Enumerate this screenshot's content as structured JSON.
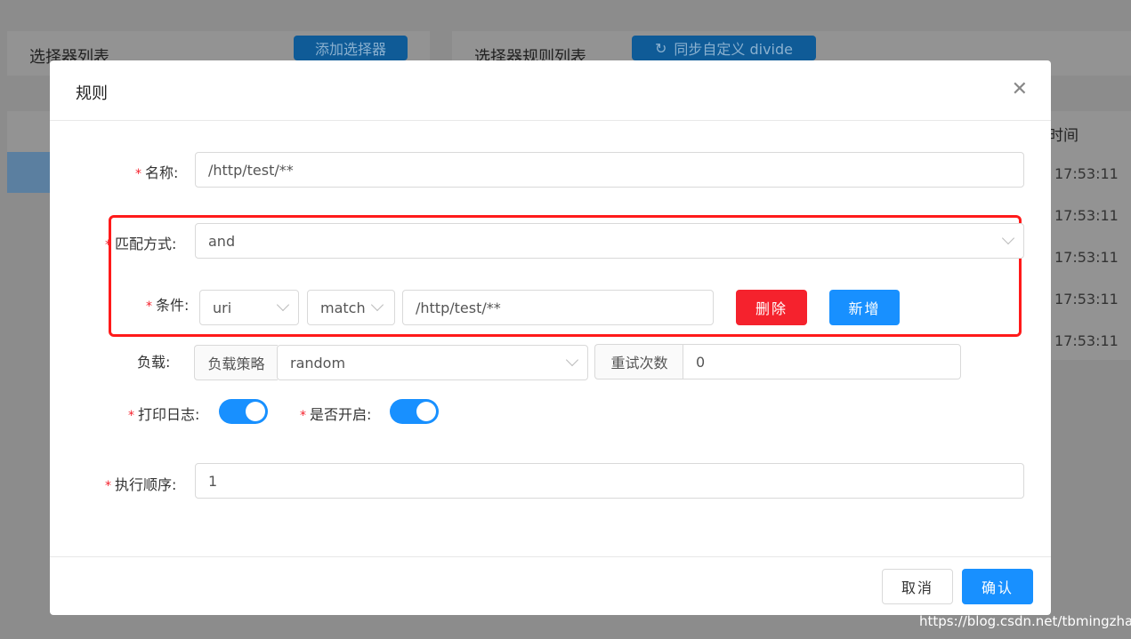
{
  "background": {
    "selector_list_title": "选择器列表",
    "add_selector_label": "添加选择器",
    "rule_list_title": "选择器规则列表",
    "sync_label": "同步自定义 divide",
    "time_header": "时间",
    "times": [
      "17:53:11",
      "17:53:11",
      "17:53:11",
      "17:53:11",
      "17:53:11"
    ]
  },
  "modal": {
    "title": "规则",
    "name_label": "名称:",
    "name_value": "/http/test/**",
    "match_label": "匹配方式:",
    "match_value": "and",
    "condition_label": "条件:",
    "condition_param": "uri",
    "condition_operator": "match",
    "condition_value": "/http/test/**",
    "delete_label": "删除",
    "add_label": "新增",
    "load_label": "负载:",
    "load_strategy_addon": "负载策略",
    "load_strategy_value": "random",
    "retry_addon": "重试次数",
    "retry_value": "0",
    "log_label": "打印日志:",
    "log_enabled": true,
    "enabled_label": "是否开启:",
    "enabled": true,
    "order_label": "执行顺序:",
    "order_value": "1",
    "cancel_label": "取消",
    "confirm_label": "确认"
  },
  "colors": {
    "primary": "#1890ff",
    "danger": "#f5222d",
    "highlight_box": "#ff1a1a"
  },
  "watermark": "https://blog.csdn.net/tbmingzhao"
}
